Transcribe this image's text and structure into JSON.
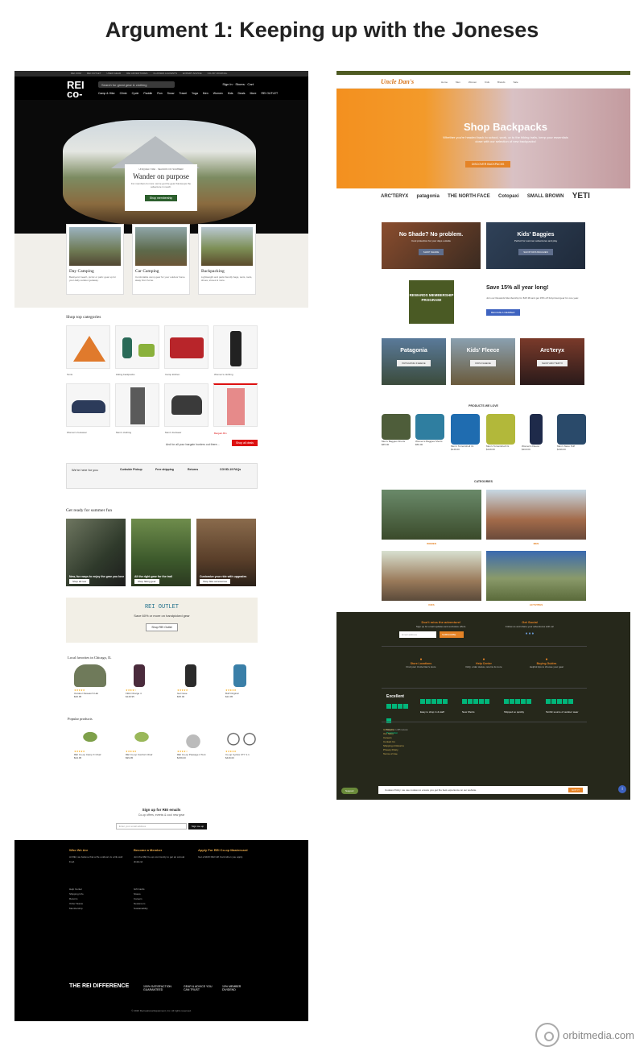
{
  "title": "Argument 1: Keeping up with the Joneses",
  "watermark": "orbitmedia.com",
  "rei": {
    "top_links": [
      "REI.COM",
      "REI OUTLET",
      "USED GEAR",
      "REI ADVENTURES",
      "CLASSES & EVENTS",
      "EXPERT ADVICE",
      "CO-OP JOURNAL",
      "CONSERVATION",
      "MEMBERSHIP"
    ],
    "logo": "REI co-op",
    "search_placeholder": "Search for great gear & clothing",
    "account": "Sign In · Stores · Cart",
    "nav": [
      "Camp & Hike",
      "Climb",
      "Cycle",
      "Paddle",
      "Run",
      "Snow",
      "Travel",
      "Yoga",
      "Men",
      "Women",
      "Kids",
      "Deals",
      "More",
      "REI OUTLET"
    ],
    "hero": {
      "kicker": "UNIQUELY REI · SEASON OF SUMMER",
      "heading": "Wander on purpose",
      "desc": "For members & more: we've got the gear that keeps the adventure in reach.",
      "button": "Shop membership"
    },
    "categories": [
      {
        "title": "Day Camping",
        "desc": "Backyard, beach, picnic or park: gear up for your daily outdoor getaway."
      },
      {
        "title": "Car Camping",
        "desc": "Comfortable camp gear for your outdoor home away from home."
      },
      {
        "title": "Backpacking",
        "desc": "Lightweight and pack-friendly bags, tents, tools, shoes, stoves & more."
      }
    ],
    "shop_top_title": "Shop top categories",
    "shop_top": [
      "Tents",
      "Hiking backpacks",
      "Camp kitchen",
      "Women's clothing",
      "Women's footwear",
      "Men's clothing",
      "Men's footwear",
      "Bargain Bin"
    ],
    "deals_text": "And for all your bargain hunters out there...",
    "deals_button": "Shop all deals",
    "services_heading": "We're here for you",
    "services": [
      "Curbside Pickup",
      "Free shipping",
      "Returns",
      "COVID-19 FAQs"
    ],
    "summer_title": "Get ready for summer fun",
    "summer": [
      {
        "caption": "New, fun ways to enjoy the gear you love",
        "button": "Shop all new"
      },
      {
        "caption": "All the right gear for the trail",
        "button": "Shop hiking gear"
      },
      {
        "caption": "Customize your ride with upgrades",
        "button": "Shop bike accessories"
      }
    ],
    "outlet": {
      "title": "REI OUTLET",
      "sub": "Save 60% or more on handpicked gear",
      "button": "Shop REI Outlet"
    },
    "local_title": "Local favorites in Chicago, IL",
    "popular_title": "Popular products",
    "local_products": [
      "Outdoor Research Hat",
      "Fitbit Charge 4",
      "Gel Case",
      "Buff Original"
    ],
    "local_prices": [
      "$36.95",
      "$149.95",
      "$35.00",
      "$24.95"
    ],
    "popular_products": [
      "REI Co-op Camp X Chair",
      "REI Co-op Comfort Chair",
      "REI Co-op Passage 2 Tent",
      "Co-op Cycles CTY 1.1"
    ],
    "popular_prices": [
      "$34.95",
      "$99.95",
      "$159.00",
      "$449.00"
    ],
    "signup": {
      "title": "Sign up for REI emails",
      "sub": "Co-op offers, events & cool new gear",
      "placeholder": "Enter your email address",
      "button": "Sign me up"
    },
    "footer": {
      "cols": [
        {
          "head": "Who We Are",
          "body": "At REI, we believe that a life outdoors is a life well lived."
        },
        {
          "head": "Become a Member",
          "body": "Join the REI Co-op community to get an annual dividend."
        },
        {
          "head": "Apply For REI Co-op Mastercard",
          "body": "Get a $100 REI Gift Card when you apply."
        }
      ],
      "links": [
        "Help Center",
        "Shipping Info",
        "Returns",
        "Order Status",
        "Membership",
        "Gift Cards",
        "Stores",
        "Careers",
        "Newsroom",
        "Sustainability"
      ],
      "difference": "THE REI DIFFERENCE",
      "badges": [
        "100% SATISFACTION GUARANTEED",
        "GEAR & ADVICE YOU CAN TRUST",
        "10% MEMBER DIVIDEND"
      ],
      "copyright": "© 2020 Recreational Equipment, Inc. All rights reserved."
    }
  },
  "ud": {
    "logo": "Uncle Dan's",
    "nav": [
      "Home",
      "Men",
      "Women",
      "Kids",
      "Brands",
      "Sale"
    ],
    "hero": {
      "heading": "Shop Backpacks",
      "desc": "Whether you're headed back to school, work, or to the hiking trails, keep your essentials close with our selection of new backpacks!",
      "button": "DISCOVER BACKPACKS"
    },
    "brands": [
      "ARC'TERYX",
      "patagonia",
      "THE NORTH FACE",
      "Cotopaxi",
      "SMALL BROWN",
      "YETI"
    ],
    "promos": [
      {
        "heading": "No Shade? No problem.",
        "desc": "Cool protection for your days outside",
        "button": "SHOP SHADE"
      },
      {
        "heading": "Kids' Baggies",
        "desc": "Perfect for summer adventures and play",
        "button": "SHOP KIDS BAGGIES"
      }
    ],
    "rewards": {
      "badge": "REWARDS MEMBERSHIP PROGRAM!",
      "heading": "Save 15% all year long!",
      "desc": "Join our Rewards Membership for $15.99 and get 15% off full-priced gear for one year.",
      "button": "BECOME A MEMBER"
    },
    "brand_tiles": [
      {
        "name": "Patagonia",
        "button": "PATAGONIA FLEECE"
      },
      {
        "name": "Kids' Fleece",
        "button": "KIDS FLEECE"
      },
      {
        "name": "Arc'teryx",
        "button": "SHOP ARC'TERYX"
      }
    ],
    "products_title": "PRODUCTS WE LOVE",
    "products": [
      "Men's Baggies Shorts",
      "Women's Baggies Shorts",
      "Men's Torrentshell 3L",
      "Men's Torrentshell 3L",
      "Women's Fleece",
      "Men's Nano Puff"
    ],
    "prices": [
      "$65.00",
      "$59.00",
      "$149.00",
      "$149.00",
      "$119.00",
      "$199.00"
    ],
    "categories_title": "CATEGORIES",
    "categories": [
      "WOMEN",
      "MEN",
      "KIDS",
      "ACTIVITIES"
    ],
    "footer": {
      "newsletter": "Don't miss the adventure!",
      "newsletter_sub": "Sign up for email updates and exclusive offers.",
      "email_placeholder": "Email address",
      "subscribe": "SUBSCRIBE",
      "social": "Get Social",
      "social_sub": "Follow us and share your adventures with us!",
      "services": [
        {
          "head": "Store Locations",
          "sub": "Find your Uncle Dan's store"
        },
        {
          "head": "Help Center",
          "sub": "FAQ, order status, returns & more"
        },
        {
          "head": "Buying Guides",
          "sub": "Helpful tips to choose your gear"
        }
      ],
      "trustpilot": {
        "label": "Excellent",
        "reviews": "Based on 1,685 reviews",
        "brand": "Trustpilot"
      },
      "reviews": [
        "Easy to shop in & staff",
        "New Shorts",
        "Shipped so quickly",
        "Terrific source of outdoor wear"
      ],
      "links": [
        "Gift Cards",
        "Our Story",
        "Careers",
        "Contact Us",
        "Shipping & Returns",
        "Privacy Policy",
        "Terms of Use"
      ],
      "cookie": "Cookies Policy: we use cookies to ensure you get the best experience on our website.",
      "cookie_button": "GOT IT",
      "support": "Support"
    }
  }
}
